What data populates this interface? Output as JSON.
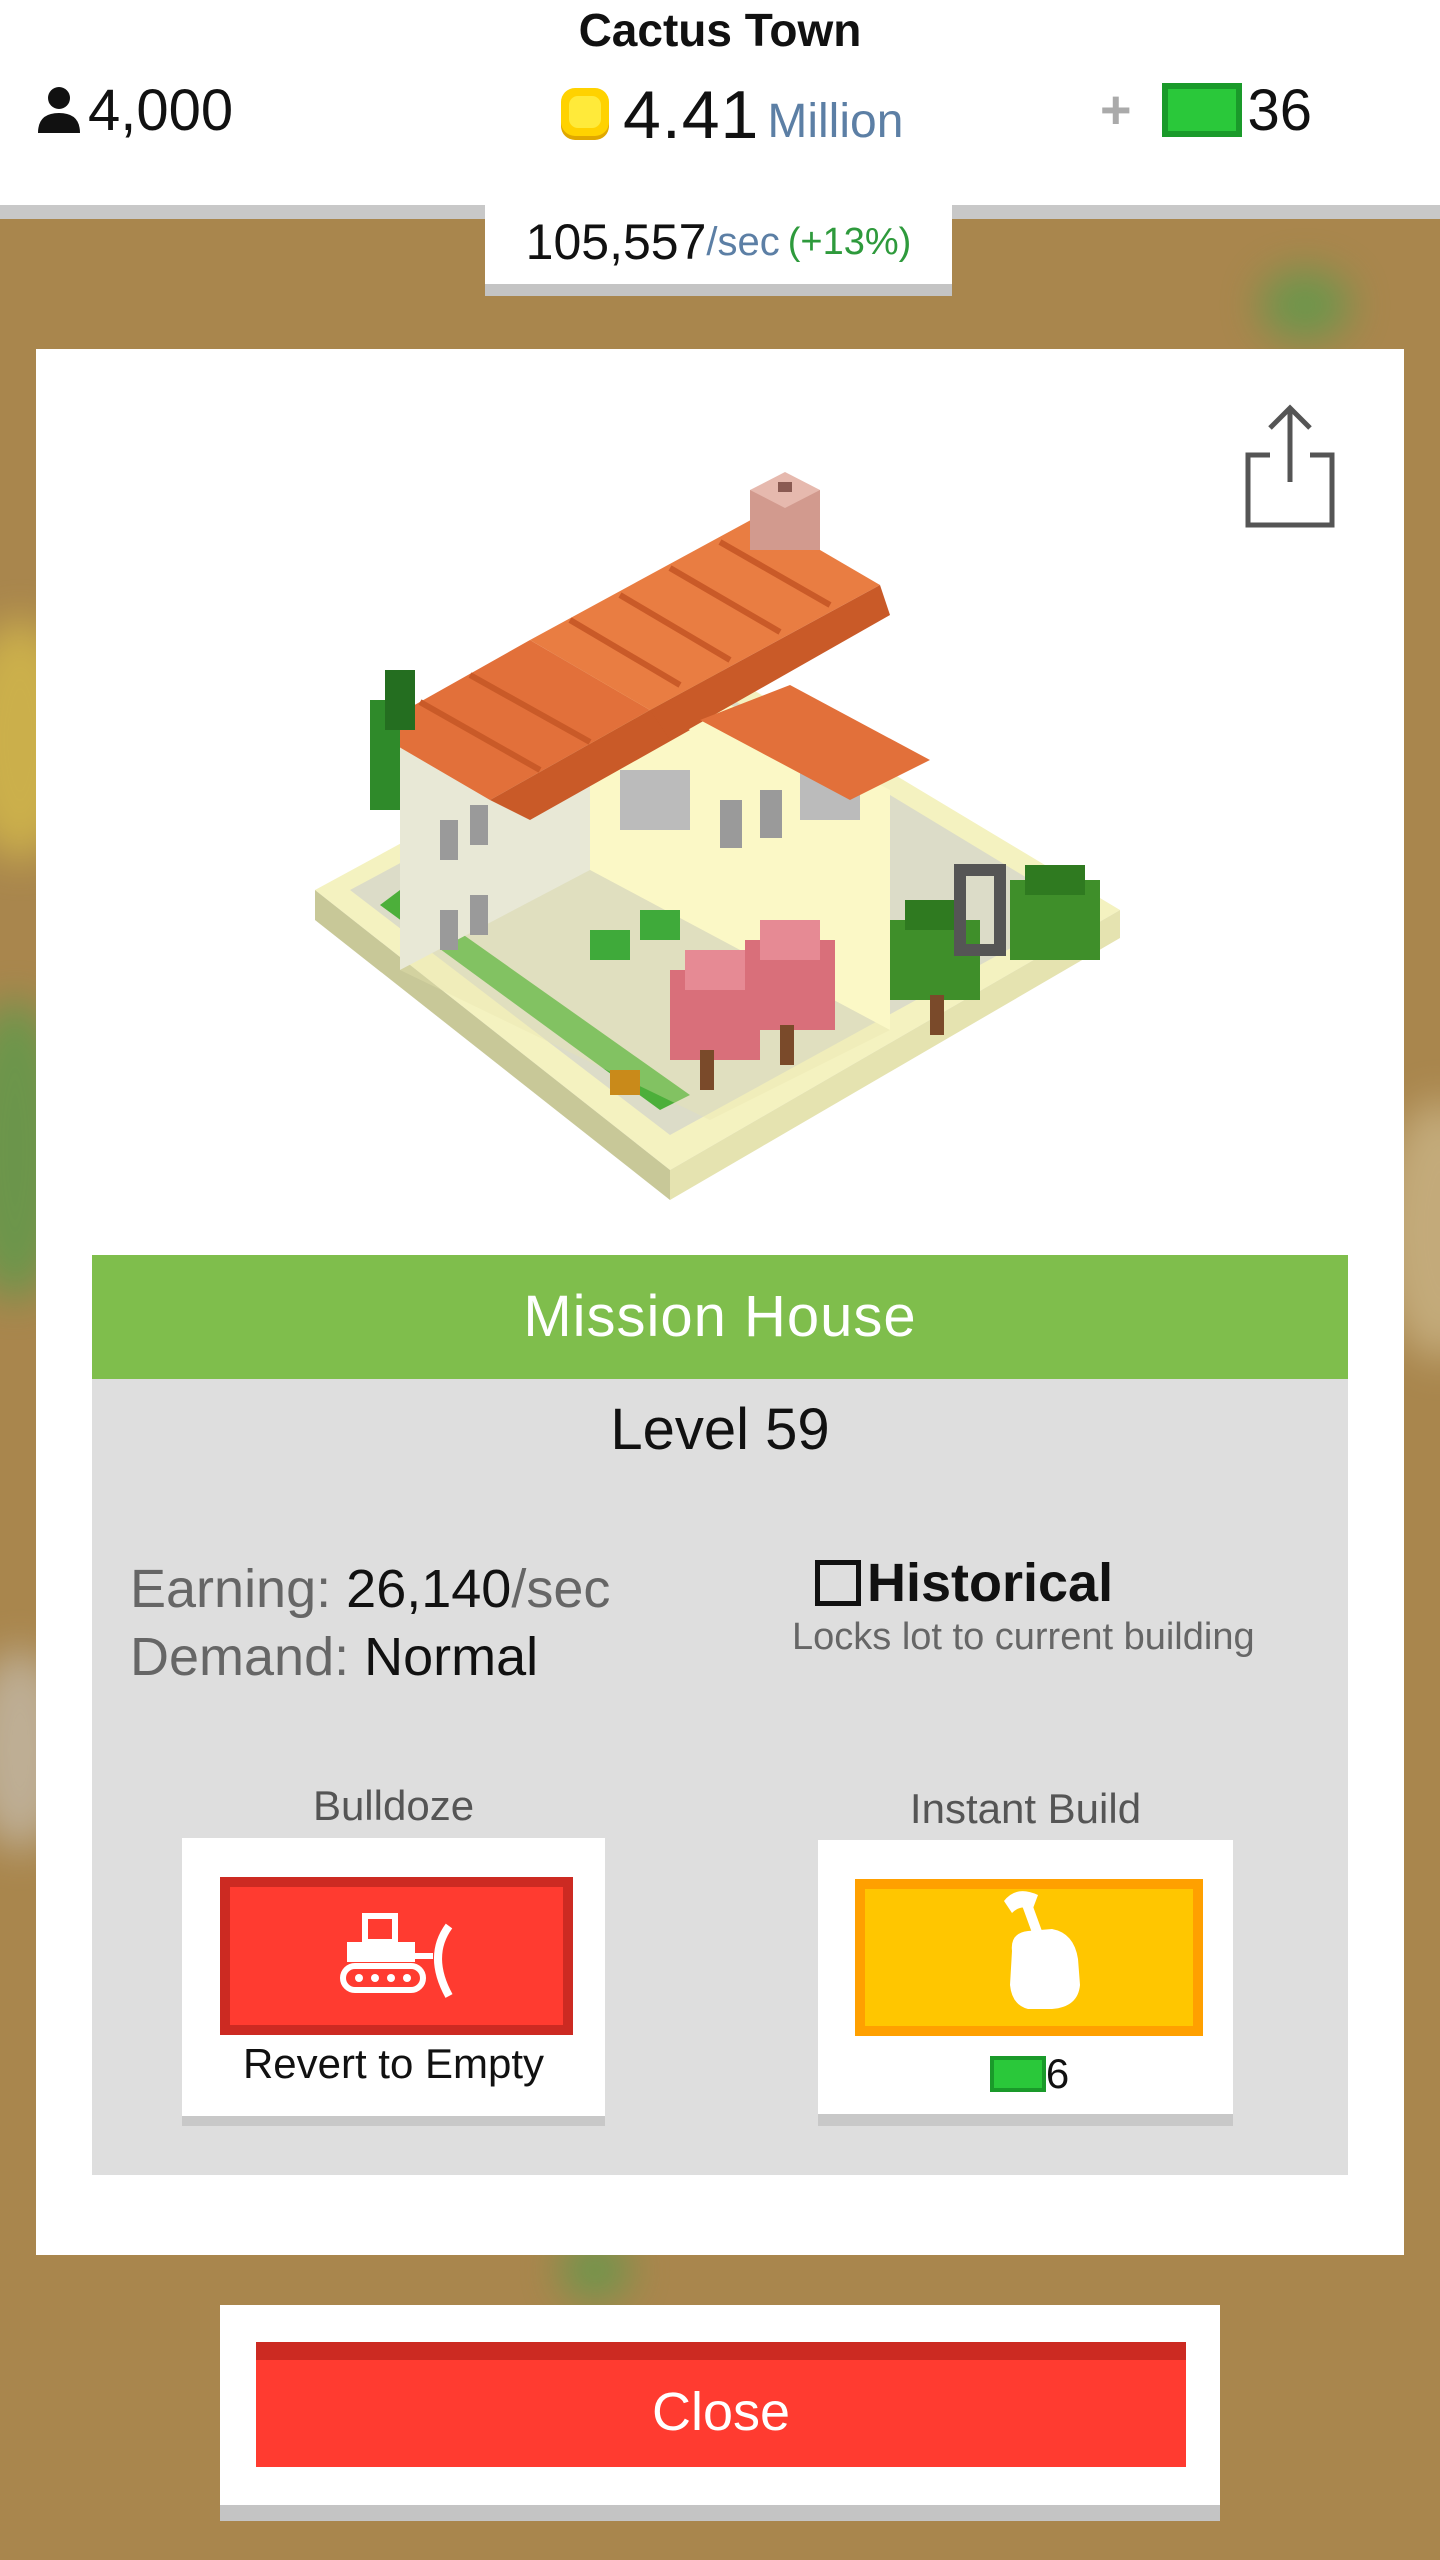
{
  "header": {
    "town_name": "Cactus Town",
    "population": "4,000",
    "coins_value": "4.41",
    "coins_unit": "Million",
    "cash_plus": "+",
    "cash_value": "36",
    "rate_value": "105,557",
    "rate_unit": "/sec",
    "rate_bonus": "(+13%)"
  },
  "building": {
    "name": "Mission House",
    "level": "Level 59",
    "earning_label": "Earning:",
    "earning_value": "26,140",
    "earning_unit": "/sec",
    "demand_label": "Demand:",
    "demand_value": "Normal",
    "historical_label": "Historical",
    "historical_checked": false,
    "historical_description": "Locks lot to current building"
  },
  "actions": {
    "bulldoze_label": "Bulldoze",
    "bulldoze_caption": "Revert to Empty",
    "instant_label": "Instant Build",
    "instant_cost": "6"
  },
  "close_label": "Close",
  "icons": {
    "population": "person-icon",
    "coins": "coin-icon",
    "cash": "cash-icon",
    "share": "share-icon",
    "bulldoze": "bulldozer-icon",
    "instant": "hammer-hand-icon"
  },
  "colors": {
    "title_bar": "#7fbe4c",
    "bulldoze": "#ff3b30",
    "instant": "#ffc600",
    "close": "#ff3b30",
    "rate_bonus": "#2e9a3c",
    "unit_blue": "#5c7fa5"
  }
}
